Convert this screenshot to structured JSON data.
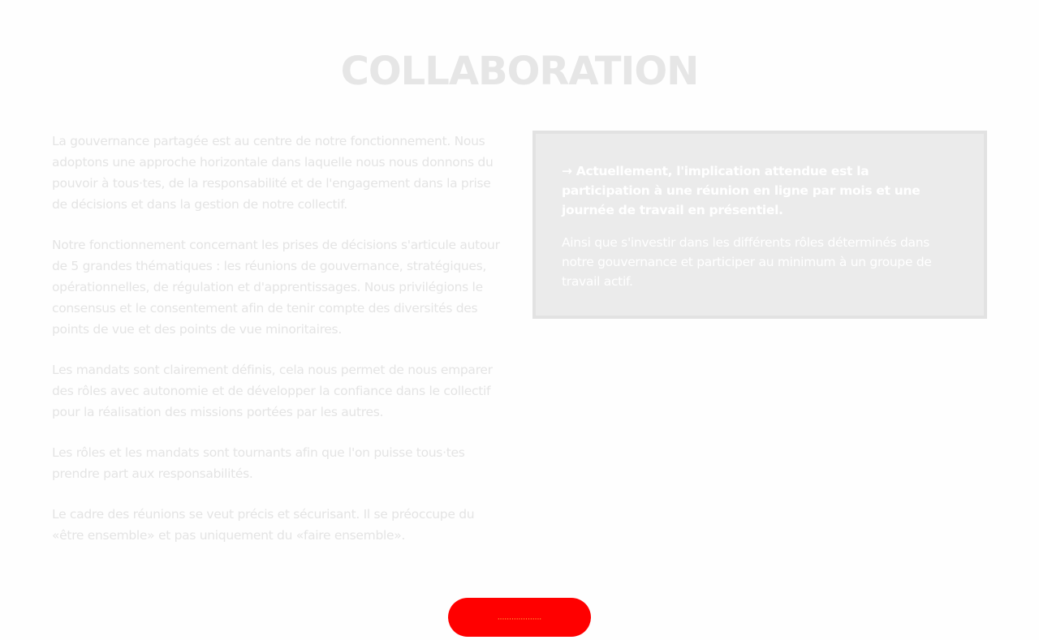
{
  "page": {
    "title": "COLLABORATION"
  },
  "main": {
    "paragraphs": [
      "La gouvernance partagée est au centre de notre fonctionnement. Nous adoptons une approche horizontale dans laquelle nous nous donnons du pouvoir à tous·tes, de la responsabilité et de l'engagement dans la prise de décisions et dans la gestion de notre collectif.",
      "Notre fonctionnement concernant les prises de décisions s'articule autour de 5 grandes thématiques : les réunions de gouvernance, stratégiques, opérationnelles, de régulation et d'apprentissages. Nous privilégions le consensus et le consentement afin de tenir compte des diversités des points de vue et des points de vue minoritaires.",
      "Les mandats sont clairement définis, cela nous permet de nous emparer des rôles avec autonomie et de développer la confiance dans le collectif pour la réalisation des missions portées par les autres.",
      "Les rôles et les mandats sont tournants afin que l'on puisse tous·tes prendre part aux responsabilités.",
      "Le cadre des réunions se veut précis et sécurisant. Il se préoccupe du «être ensemble» et pas uniquement du «faire ensemble»."
    ]
  },
  "info_box": {
    "highlight": "→ Actuellement, l'implication attendue est la participation à une réunion en ligne par mois et une journée de travail en présentiel.",
    "detail": "Ainsi que s'investir dans les différents rôles déterminés dans notre gouvernance et participer au minimum à un groupe de travail actif."
  },
  "cta": {
    "label": "···················"
  },
  "colors": {
    "cta_background": "#ff0000",
    "cta_text": "#ffd24a",
    "info_box_background": "#ebebeb",
    "body_text": "#e4e4e4"
  }
}
